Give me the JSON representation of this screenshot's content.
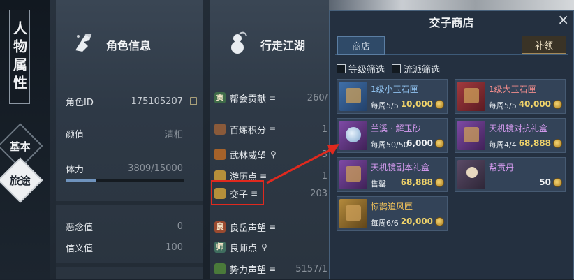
{
  "sidebar": {
    "title": "人物属性",
    "tabs": [
      {
        "label": "基本",
        "selected": false
      },
      {
        "label": "旅途",
        "selected": true
      }
    ]
  },
  "role_panel": {
    "title": "角色信息",
    "rows": {
      "role_id": {
        "label": "角色ID",
        "value": "175105207"
      },
      "looks": {
        "label": "颜值",
        "value": "清相"
      },
      "stamina": {
        "label": "体力",
        "value": "3809/15000",
        "fill_fraction": 0.254
      },
      "evil": {
        "label": "恶念值",
        "value": "0"
      },
      "justice": {
        "label": "信义值",
        "value": "100"
      }
    }
  },
  "travel_panel": {
    "title": "行走江湖",
    "rows": [
      {
        "icon": "guild-contribution-icon",
        "glyph": "贡",
        "label": "帮会贡献",
        "value": "260/",
        "info": "eq"
      },
      {
        "icon": "refine-points-icon",
        "glyph": "",
        "label": "百炼积分",
        "value": "1",
        "info": "eq"
      },
      {
        "icon": "martial-prestige-icon",
        "glyph": "",
        "label": "武林威望",
        "value": "3",
        "info": "pin",
        "orange": true
      },
      {
        "icon": "travel-points-icon",
        "glyph": "",
        "label": "游历点",
        "value": "1",
        "info": "eq"
      },
      {
        "icon": "jiaozi-icon",
        "glyph": "",
        "label": "交子",
        "value": "203",
        "info": "eq"
      },
      {
        "icon": "liangyue-prestige-icon",
        "glyph": "良",
        "label": "良岳声望",
        "value": "",
        "info": "eq"
      },
      {
        "icon": "mentor-points-icon",
        "glyph": "师",
        "label": "良师点",
        "value": "",
        "info": "pin"
      },
      {
        "icon": "faction-prestige-icon",
        "glyph": "",
        "label": "势力声望",
        "value": "5157/1",
        "info": "eq"
      }
    ]
  },
  "shop": {
    "title": "交子商店",
    "close": "×",
    "tab": "商店",
    "claim_button": "补领",
    "filters": [
      "等级筛选",
      "流派筛选"
    ],
    "items": [
      {
        "name": "1级小玉石匣",
        "limit": "每周5/5",
        "price": "10,000",
        "name_color": "blue",
        "img": "blue",
        "price_color": "yellow"
      },
      {
        "name": "1级大玉石匣",
        "limit": "每周5/5",
        "price": "40,000",
        "name_color": "red",
        "img": "red",
        "price_color": "yellow"
      },
      {
        "name": "兰溪 · 解玉砂",
        "limit": "每周50/50",
        "price": "6,000",
        "name_color": "purple",
        "img": "purple-orb",
        "price_color": "white"
      },
      {
        "name": "天机镜对抗礼盒",
        "limit": "每周4/4",
        "price": "68,888",
        "name_color": "purple",
        "img": "purple",
        "price_color": "yellow"
      },
      {
        "name": "天机镜副本礼盒",
        "limit": "售罄",
        "price": "68,888",
        "name_color": "purple",
        "img": "purple",
        "price_color": "yellow"
      },
      {
        "name": "帮贡丹",
        "limit": "",
        "price": "50",
        "name_color": "purple",
        "img": "grey-pill",
        "price_color": "white"
      },
      {
        "name": "惊鹊追风匣",
        "limit": "每周6/6",
        "price": "20,000",
        "name_color": "gold",
        "img": "gold",
        "price_color": "yellow"
      }
    ]
  },
  "colors": {
    "highlight_box": "#e0291e",
    "arrow": "#e0291e",
    "accent_blue": "#2f4a68"
  }
}
